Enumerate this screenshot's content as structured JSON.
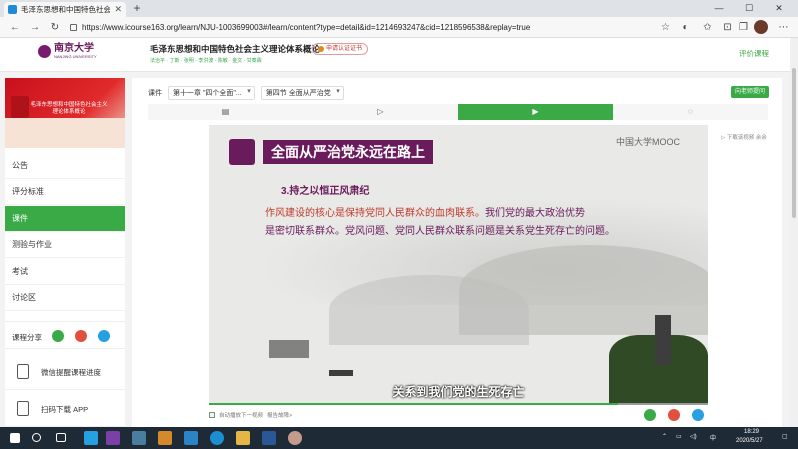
{
  "browser": {
    "tab_title": "毛泽东思想和中国特色社会...",
    "tab_close": "✕",
    "new_tab": "+",
    "url": "https://www.icourse163.org/learn/NJU-1003699003#/learn/content?type=detail&id=1214693247&cid=1218596538&replay=true",
    "win_controls": [
      "—",
      "☐",
      "✕"
    ]
  },
  "site": {
    "logo_name": "南京大学",
    "logo_sub": "NANJING UNIVERSITY",
    "course_title": "毛泽东思想和中国特色社会主义理论体系概论",
    "course_tags": "法治平 · 丁斯 · 张明 · 李洪波 · 陈敏 · 金文 · 甘泰霖",
    "cert_button": "申请认证证书",
    "evaluate_link": "评价课程"
  },
  "sidebar": {
    "cover_title": "毛泽东思想和中国特色社会主义理论体系概论",
    "items": [
      {
        "label": "公告"
      },
      {
        "label": "评分标准"
      },
      {
        "label": "课件"
      },
      {
        "label": "测验与作业"
      },
      {
        "label": "考试"
      },
      {
        "label": "讨论区"
      }
    ],
    "share_label": "课程分享",
    "tools": [
      {
        "label": "微信提醒课程进度"
      },
      {
        "label": "扫码下载 APP"
      }
    ]
  },
  "breadcrumb": {
    "root": "课件",
    "chapter": "第十一章 \"四个全面\"...",
    "section": "第四节 全面从严治党",
    "action_button": "向老师提问"
  },
  "tabs": [
    {
      "icon": "document-icon",
      "glyph": "▤"
    },
    {
      "icon": "play-outline-icon",
      "glyph": "▷"
    },
    {
      "icon": "video-icon",
      "glyph": "▶"
    },
    {
      "icon": "comment-icon",
      "glyph": "◌"
    }
  ],
  "video": {
    "slide_title": "全面从严治党永远在路上",
    "watermark": "中国大学MOOC",
    "subheading": "3.持之以恒正风肃纪",
    "para_red": "作风建设的核心是保持党同人民群众的血肉联系。",
    "para_rest_1": "我们党的最大政治优势",
    "para_rest_2": "是密切联系群众。党风问题、党同人民群众联系问题是关系党生死存亡的问题。",
    "caption": "关系到我们党的生死存亡",
    "progress": 0.82
  },
  "side_panel": "▷ 下载该视频  余余",
  "video_footer": {
    "autoplay": "自动播放下一视频",
    "report": "报告故障>"
  },
  "taskbar": {
    "time": "18:29",
    "date": "2020/5/27",
    "ime": "中"
  },
  "colors": {
    "accent": "#3aaa46",
    "brand_purple": "#6a1b5b",
    "alert_red": "#c0392b"
  }
}
